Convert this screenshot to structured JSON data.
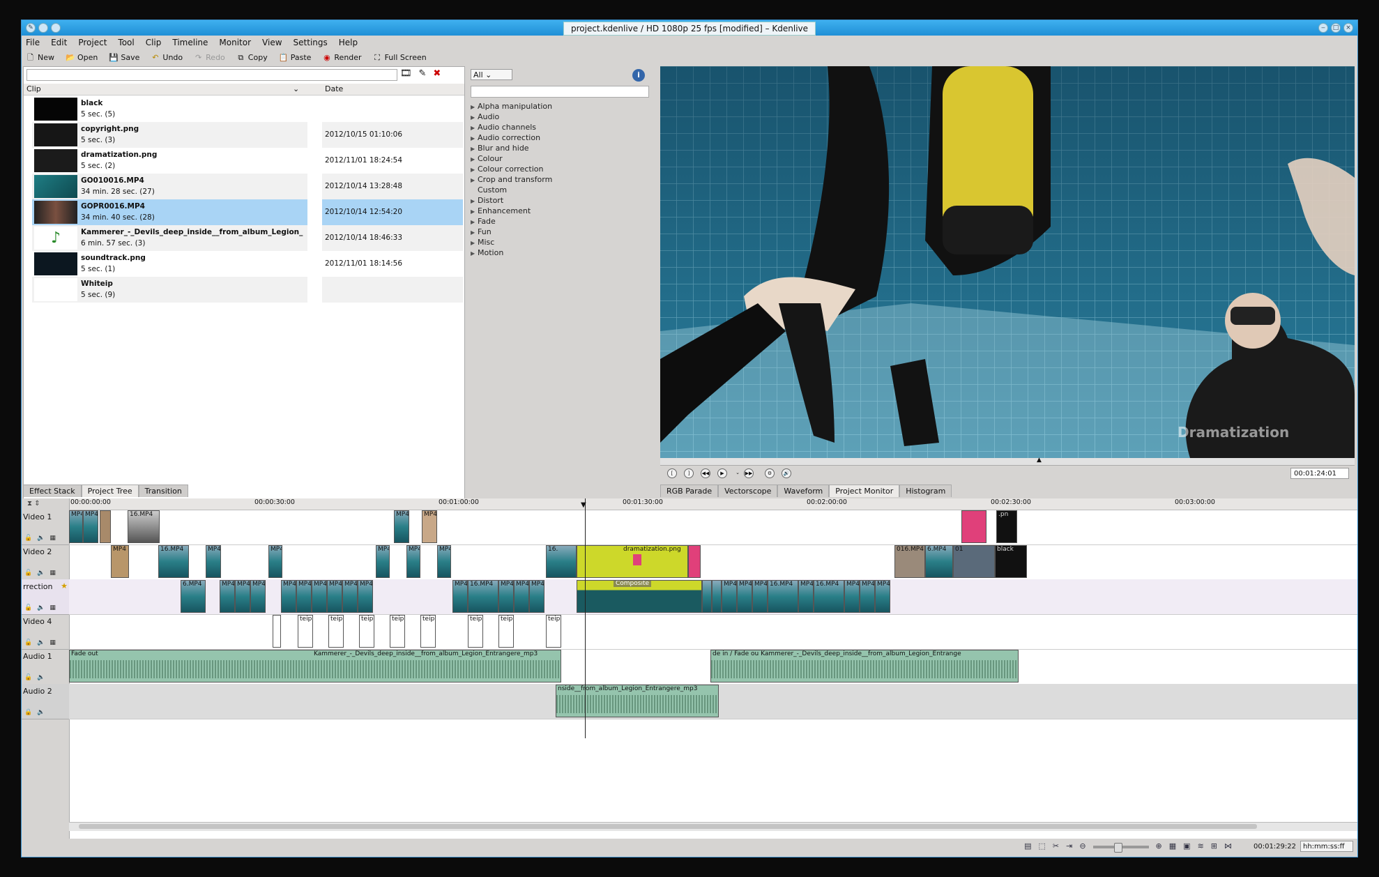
{
  "window": {
    "title": "project.kdenlive / HD 1080p 25 fps [modified] – Kdenlive"
  },
  "menu": [
    "File",
    "Edit",
    "Project",
    "Tool",
    "Clip",
    "Timeline",
    "Monitor",
    "View",
    "Settings",
    "Help"
  ],
  "toolbar": {
    "new": "New",
    "open": "Open",
    "save": "Save",
    "undo": "Undo",
    "redo": "Redo",
    "copy": "Copy",
    "paste": "Paste",
    "render": "Render",
    "fullscreen": "Full Screen"
  },
  "bin": {
    "col_clip": "Clip",
    "col_date": "Date",
    "clips": [
      {
        "name": "black",
        "duration": "5 sec. (5)",
        "date": "",
        "thumb": "#050505"
      },
      {
        "name": "copyright.png",
        "duration": "5 sec. (3)",
        "date": "2012/10/15 01:10:06",
        "thumb": "#161616"
      },
      {
        "name": "dramatization.png",
        "duration": "5 sec. (2)",
        "date": "2012/11/01 18:24:54",
        "thumb": "#1b1b1b"
      },
      {
        "name": "GO010016.MP4",
        "duration": "34 min. 28 sec. (27)",
        "date": "2012/10/14 13:28:48",
        "thumb": "#1f7d84"
      },
      {
        "name": "GOPR0016.MP4",
        "duration": "34 min. 40 sec. (28)",
        "date": "2012/10/14 12:54:20",
        "thumb": "#3a3a3a"
      },
      {
        "name": "Kammerer_-_Devils_deep_inside__from_album_Legion_",
        "duration": "6 min. 57 sec. (3)",
        "date": "2012/10/14 18:46:33",
        "thumb": "#ffffff"
      },
      {
        "name": "soundtrack.png",
        "duration": "5 sec. (1)",
        "date": "2012/11/01 18:14:56",
        "thumb": "#0c1720"
      },
      {
        "name": "Whiteip",
        "duration": "5 sec. (9)",
        "date": "",
        "thumb": "#ffffff"
      }
    ]
  },
  "effects": {
    "filter": "All",
    "info_label": "i",
    "categories": [
      "Alpha manipulation",
      "Audio",
      "Audio channels",
      "Audio correction",
      "Blur and hide",
      "Colour",
      "Colour correction",
      "Crop and transform",
      "Custom",
      "Distort",
      "Enhancement",
      "Fade",
      "Fun",
      "Misc",
      "Motion"
    ]
  },
  "monitor": {
    "watermark": "Dramatization",
    "timecode": "00:01:24:01"
  },
  "left_tabs": [
    "Effect Stack",
    "Project Tree",
    "Transition"
  ],
  "right_tabs": [
    "RGB Parade",
    "Vectorscope",
    "Waveform",
    "Project Monitor",
    "Histogram"
  ],
  "timeline": {
    "ruler": [
      "00:00:00:00",
      "00:00:30:00",
      "00:01:00:00",
      "00:01:30:00",
      "00:02:00:00",
      "00:02:30:00",
      "00:03:00:00"
    ],
    "tracks": [
      "Video 1",
      "Video 2",
      "rrection",
      "Video 4",
      "Audio 1",
      "Audio 2"
    ],
    "audio1_clip_a": "Fade out",
    "audio1_clip_a2": "Kammerer_-_Devils_deep_inside__from_album_Legion_Entrangere_mp3",
    "audio1_clip_b": "de in / Fade ou Kammerer_-_Devils_deep_inside__from_album_Legion_Entrange",
    "audio2_clip": "nside__from_album_Legion_Entrangere_mp3",
    "composite_label": "Composite",
    "dram_clip": "dramatization.png",
    "black_label": "black"
  },
  "status": {
    "timecode": "00:01:29:22",
    "format": "hh:mm:ss:ff"
  }
}
